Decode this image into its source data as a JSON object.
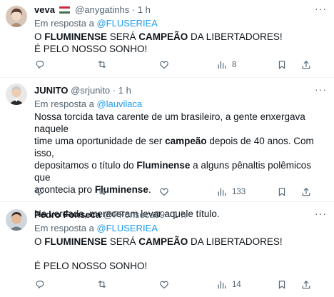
{
  "tweets": [
    {
      "name": "veva",
      "handle": "@anygatinhs",
      "time": "· 1 h",
      "reply_prefix": "Em resposta a",
      "reply_to": "@FLUSERIEA",
      "text": [
        [
          {
            "t": "O "
          },
          {
            "t": "FLUMINENSE",
            "b": true
          },
          {
            "t": " SERÁ "
          },
          {
            "t": "CAMPEÃO",
            "b": true
          },
          {
            "t": " DA LIBERTADORES!"
          }
        ],
        [
          {
            "t": "É PELO NOSSO SONHO!"
          }
        ]
      ],
      "views": "8",
      "more": "···"
    },
    {
      "name": "JUNITO",
      "handle": "@srjunito",
      "time": "· 1 h",
      "reply_prefix": "Em resposta a",
      "reply_to": "@lauvilaca",
      "text": [
        [
          {
            "t": "Nossa torcida tava carente de um brasileiro, a gente enxergava naquele"
          }
        ],
        [
          {
            "t": "time uma oportunidade de ser "
          },
          {
            "t": "campeão",
            "b": true
          },
          {
            "t": " depois de 40 anos. Com isso,"
          }
        ],
        [
          {
            "t": "depositamos o título do "
          },
          {
            "t": "Fluminense",
            "b": true
          },
          {
            "t": " a alguns pênaltis polêmicos que"
          }
        ],
        [
          {
            "t": "acontecia pro "
          },
          {
            "t": "Fluminense",
            "b": true
          },
          {
            "t": "."
          }
        ],
        [],
        [
          {
            "t": "Na verdade, mereceram levar aquele título."
          }
        ]
      ],
      "views": "133",
      "more": "···"
    },
    {
      "name": "Pedro Fonseca",
      "handle": "@PFonseca89",
      "time": "· 1 h",
      "reply_prefix": "Em resposta a",
      "reply_to": "@FLUSERIEA",
      "text": [
        [
          {
            "t": "O "
          },
          {
            "t": "FLUMINENSE",
            "b": true
          },
          {
            "t": " SERÁ "
          },
          {
            "t": "CAMPEÃO",
            "b": true
          },
          {
            "t": " DA LIBERTADORES!"
          }
        ],
        [],
        [
          {
            "t": "É PELO NOSSO SONHO!"
          }
        ]
      ],
      "views": "14",
      "more": "···"
    }
  ],
  "colors": {
    "link": "#1d9bf0",
    "muted": "#536471",
    "text": "#0f1419"
  }
}
